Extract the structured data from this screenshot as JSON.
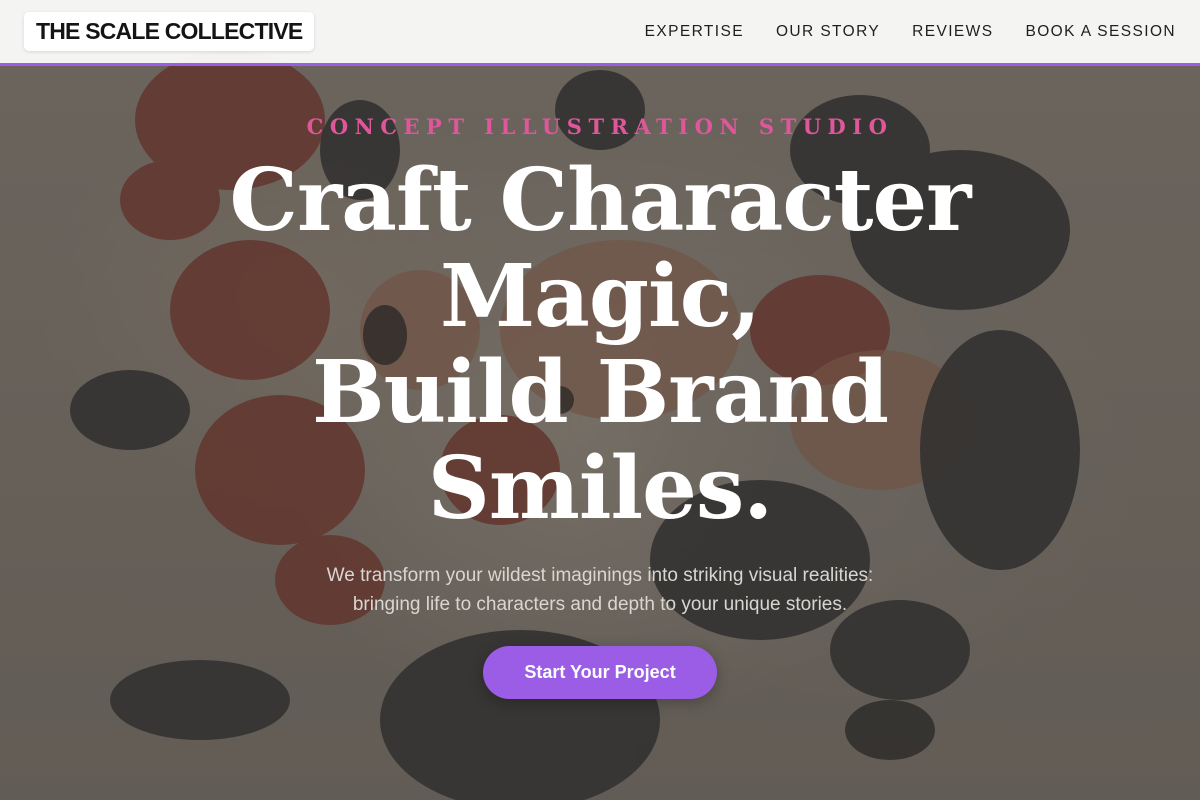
{
  "header": {
    "logo": "THE SCALE COLLECTIVE",
    "nav": [
      {
        "label": "EXPERTISE"
      },
      {
        "label": "OUR STORY"
      },
      {
        "label": "REVIEWS"
      },
      {
        "label": "BOOK A SESSION"
      }
    ]
  },
  "hero": {
    "eyebrow": "CONCEPT ILLUSTRATION STUDIO",
    "headline": [
      "Craft Character",
      "Magic,",
      "Build Brand",
      "Smiles."
    ],
    "subcopy": [
      "We transform your wildest imaginings into striking visual realities:",
      "bringing life to characters and depth to your unique stories."
    ],
    "cta_label": "Start Your Project"
  },
  "colors": {
    "accent": "#9b5de5",
    "eyebrow": "#e0569b",
    "headline": "#ffffff"
  },
  "background": {
    "icon": "botanical-flowers-engraving"
  }
}
